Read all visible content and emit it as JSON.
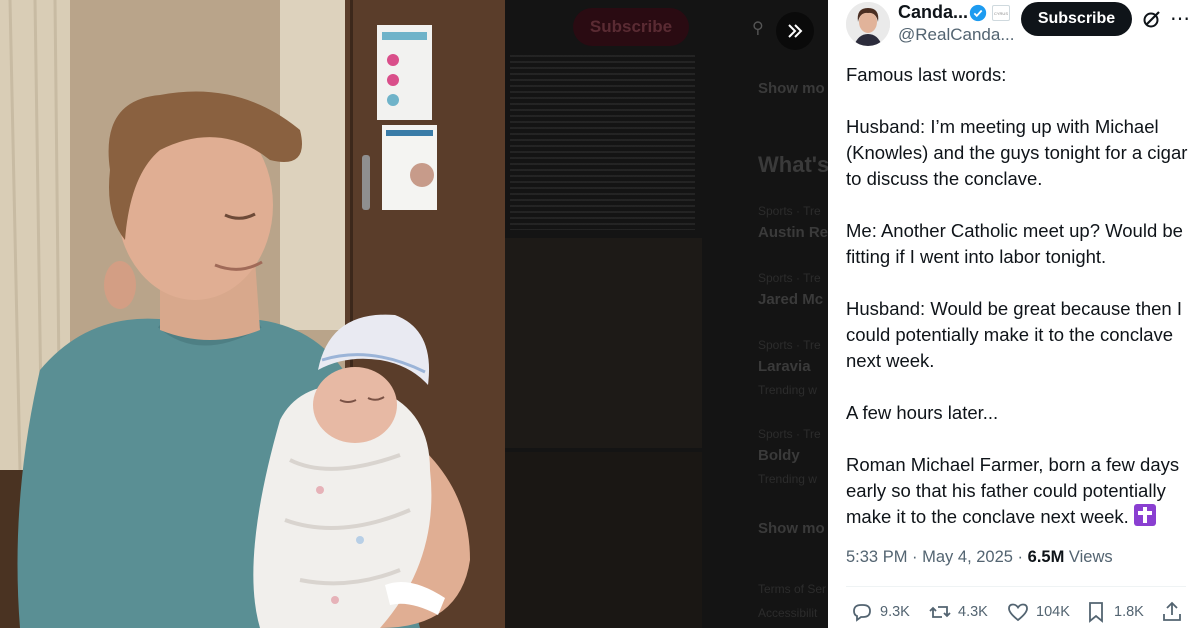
{
  "background_page": {
    "subscribe_label": "Subscribe",
    "show_more_1": "Show mo",
    "whats_happening": "What's",
    "trends": [
      {
        "context": "Sports · Tre",
        "title": "Austin Re"
      },
      {
        "context": "Sports · Tre",
        "title": "Jared Mc"
      },
      {
        "context": "Sports · Tre",
        "title": "Laravia",
        "sub": "Trending w"
      },
      {
        "context": "Sports · Tre",
        "title": "Boldy",
        "sub": "Trending w"
      }
    ],
    "show_more_2": "Show mo",
    "footer_1": "Terms of Ser",
    "footer_2": "Accessibilit"
  },
  "author": {
    "name": "Canda...",
    "handle": "@RealCanda...",
    "verified": true,
    "affiliate_badge_text": "CYRUS"
  },
  "header": {
    "subscribe_label": "Subscribe",
    "grok_icon": "grok-icon",
    "more_icon": "more-icon",
    "expand_icon": "expand-icon"
  },
  "tweet": {
    "paragraphs": [
      "Famous last words:",
      "Husband: I’m meeting up with Michael (Knowles) and the guys tonight for a cigar to discuss the conclave.",
      "Me: Another Catholic meet up? Would be fitting if I went into labor tonight.",
      "Husband: Would be great because then I could potentially make it to the conclave next week.",
      "A few hours later...",
      "Roman Michael Farmer, born a few days early so that his father could potentially make it to the conclave next week."
    ],
    "emoji": "latin-cross-emoji"
  },
  "meta": {
    "time": "5:33 PM",
    "sep1": "·",
    "date": "May 4, 2025",
    "sep2": "·",
    "views_count": "6.5M",
    "views_label": "Views"
  },
  "actions": {
    "replies": "9.3K",
    "reposts": "4.3K",
    "likes": "104K",
    "bookmarks": "1.8K"
  },
  "colors": {
    "text": "#0f1419",
    "secondary": "#536471",
    "verified_blue": "#1d9bf0",
    "emoji_purple": "#8a3fd1"
  }
}
